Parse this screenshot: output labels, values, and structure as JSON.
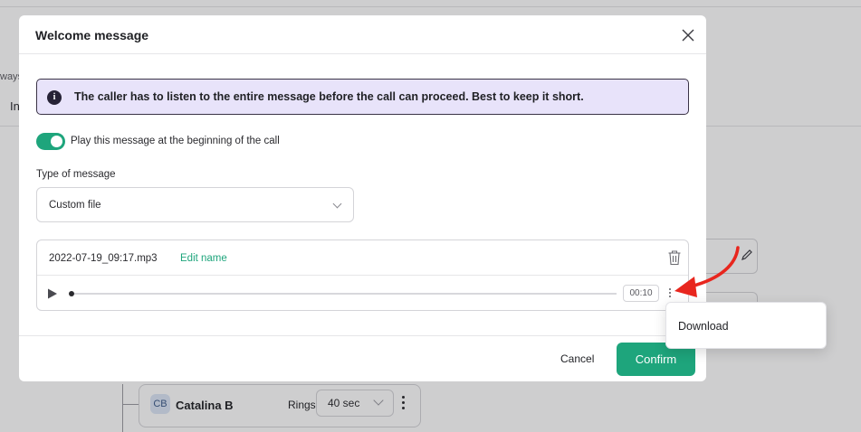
{
  "background": {
    "partial_text_left": "ways",
    "partial_tab": "In",
    "agent_card": {
      "initials": "CB",
      "name": "Catalina B",
      "rings_label": "Rings",
      "rings_value": "40 sec"
    }
  },
  "modal": {
    "title": "Welcome message",
    "info_text": "The caller has to listen to the entire message before the call can proceed. Best to keep it short.",
    "toggle": {
      "label": "Play this message at the beginning of the call",
      "on": true
    },
    "type_of_message": {
      "label": "Type of message",
      "value": "Custom file"
    },
    "file": {
      "name": "2022-07-19_09:17.mp3",
      "edit_label": "Edit name",
      "duration": "00:10"
    },
    "footer": {
      "cancel_label": "Cancel",
      "confirm_label": "Confirm"
    }
  },
  "more_menu": {
    "items": [
      "Download"
    ]
  },
  "colors": {
    "accent": "#1ea57c",
    "info_bg": "#e8e3fa",
    "annotation_arrow": "#e8261e"
  }
}
